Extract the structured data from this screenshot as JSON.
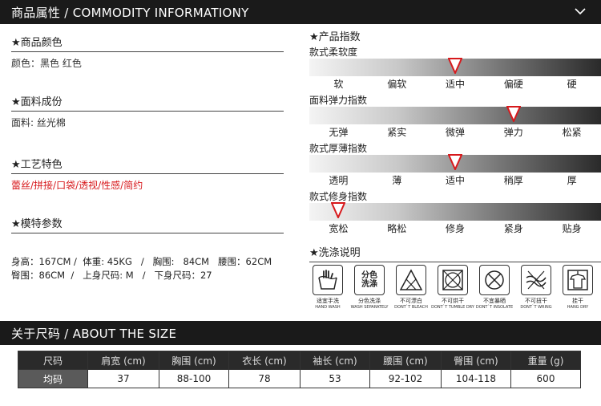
{
  "header1": {
    "title": "商品属性 / COMMODITY INFORMATIONY",
    "chevron": "chevron-down-icon"
  },
  "header2": {
    "title": "关于尺码 / ABOUT THE SIZE",
    "chevron": "chevron-down-icon"
  },
  "color": {
    "title": "★商品颜色",
    "value": "颜色：黑色   红色"
  },
  "fabric": {
    "title": "★面料成份",
    "value": "面料: 丝光棉"
  },
  "craft": {
    "title": "★工艺特色",
    "value": "蕾丝/拼接/口袋/透视/性感/简约",
    "value_color": "#d7191c"
  },
  "model": {
    "title": "★模特参数",
    "line1": "身高：167CM /  体重: 45KG   /   胸围:   84CM   腰围：62CM",
    "line2": "臀围：86CM  /   上身尺码: M   /   下身尺码：27"
  },
  "indices": {
    "title": "★产品指数",
    "rows": [
      {
        "title": "款式柔软度",
        "labels": [
          "软",
          "偏软",
          "适中",
          "偏硬",
          "硬"
        ],
        "selected": 2
      },
      {
        "title": "面料弹力指数",
        "labels": [
          "无弹",
          "紧实",
          "微弹",
          "弹力",
          "松紧"
        ],
        "selected": 3
      },
      {
        "title": "款式厚薄指数",
        "labels": [
          "透明",
          "薄",
          "适中",
          "稍厚",
          "厚"
        ],
        "selected": 2
      },
      {
        "title": "款式修身指数",
        "labels": [
          "宽松",
          "略松",
          "修身",
          "紧身",
          "贴身"
        ],
        "selected": 0
      }
    ]
  },
  "wash": {
    "title": "★洗涤说明",
    "items": [
      {
        "icon": "hand-wash-icon",
        "cn": "适宜手洗",
        "en": "HAND WASH"
      },
      {
        "icon": "wash-separately-icon",
        "cn": "分色洗涤",
        "en": "WASH SEPARATELY",
        "box_text1": "分色",
        "box_text2": "洗涤"
      },
      {
        "icon": "no-bleach-icon",
        "cn": "不可漂白",
        "en": "DONT`T BLEACH"
      },
      {
        "icon": "no-tumble-dry-icon",
        "cn": "不可烘干",
        "en": "DONT`T TUMBLE DRY"
      },
      {
        "icon": "no-insolate-icon",
        "cn": "不宜暴晒",
        "en": "DONT`T INSOLATE"
      },
      {
        "icon": "no-wring-icon",
        "cn": "不可扭干",
        "en": "DONT`T WRING"
      },
      {
        "icon": "hang-dry-icon",
        "cn": "挂干",
        "en": "HANG DRY"
      }
    ]
  },
  "size_table": {
    "headers": [
      "尺码",
      "肩宽 (cm)",
      "胸围 (cm)",
      "衣长 (cm)",
      "袖长 (cm)",
      "腰围 (cm)",
      "臀围 (cm)",
      "重量 (g)"
    ],
    "rows": [
      [
        "均码",
        "37",
        "88-100",
        "78",
        "53",
        "92-102",
        "104-118",
        "600"
      ]
    ]
  }
}
